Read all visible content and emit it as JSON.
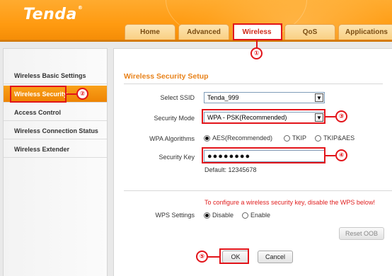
{
  "header": {
    "logo": "Tenda",
    "logo_mark": "®"
  },
  "tabs": [
    {
      "label": "Home"
    },
    {
      "label": "Advanced"
    },
    {
      "label": "Wireless"
    },
    {
      "label": "QoS"
    },
    {
      "label": "Applications"
    }
  ],
  "sidebar": {
    "items": [
      {
        "label": "Wireless Basic Settings"
      },
      {
        "label": "Wireless Security"
      },
      {
        "label": "Access Control"
      },
      {
        "label": "Wireless Connection Status"
      },
      {
        "label": "Wireless Extender"
      }
    ]
  },
  "main": {
    "title": "Wireless Security Setup",
    "ssid": {
      "label": "Select SSID",
      "value": "Tenda_999"
    },
    "security_mode": {
      "label": "Security Mode",
      "value": "WPA - PSK(Recommended)"
    },
    "wpa_algorithms": {
      "label": "WPA Algorithms",
      "options": [
        "AES(Recommended)",
        "TKIP",
        "TKIP&AES"
      ],
      "selected": "AES(Recommended)"
    },
    "security_key": {
      "label": "Security Key",
      "value": "●●●●●●●●",
      "default": "Default: 12345678"
    },
    "wps_notice": "To configure a wireless security key, disable the WPS below!",
    "wps": {
      "label": "WPS Settings",
      "options": [
        "Disable",
        "Enable"
      ],
      "selected": "Disable"
    },
    "reset_oob": "Reset OOB",
    "ok": "OK",
    "cancel": "Cancel"
  },
  "annotations": [
    "①",
    "②",
    "③",
    "④",
    "⑤"
  ],
  "colors": {
    "header_orange": "#ff9a10",
    "title_orange": "#e8821a",
    "active_tab_text": "#d02a1a",
    "warning_red": "#e02020",
    "annotation_red": "#e2141a"
  }
}
